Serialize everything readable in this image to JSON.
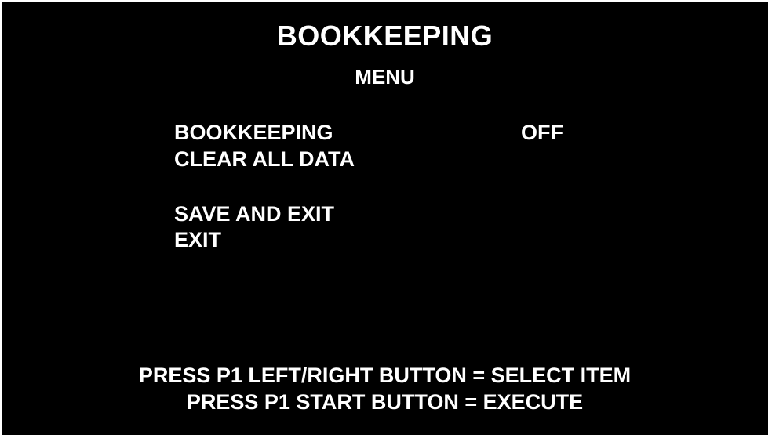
{
  "screen": {
    "title": "BOOKKEEPING",
    "subtitle": "MENU"
  },
  "menu": {
    "items": [
      {
        "label": "BOOKKEEPING",
        "value": "OFF"
      },
      {
        "label": "CLEAR ALL DATA"
      },
      {
        "label": "SAVE AND EXIT"
      },
      {
        "label": "EXIT"
      }
    ]
  },
  "instructions": {
    "line1": "PRESS P1 LEFT/RIGHT BUTTON = SELECT ITEM",
    "line2": "PRESS P1 START BUTTON = EXECUTE"
  },
  "colors": {
    "background": "#000000",
    "text": "#ffffff"
  }
}
